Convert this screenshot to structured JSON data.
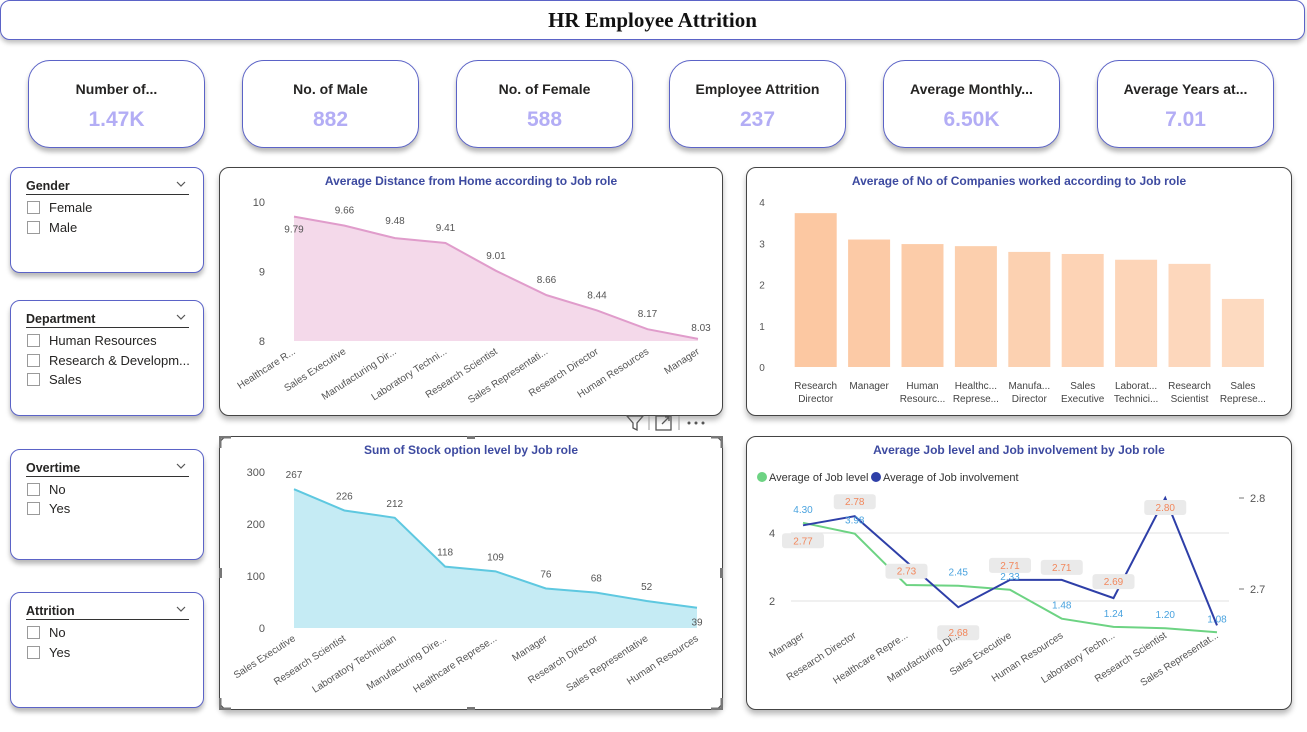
{
  "header": {
    "title": "HR Employee Attrition"
  },
  "kpis": [
    {
      "label": "Number of...",
      "value": "1.47K"
    },
    {
      "label": "No. of Male",
      "value": "882"
    },
    {
      "label": "No. of Female",
      "value": "588"
    },
    {
      "label": "Employee Attrition",
      "value": "237"
    },
    {
      "label": "Average Monthly...",
      "value": "6.50K"
    },
    {
      "label": "Average Years at...",
      "value": "7.01"
    }
  ],
  "slicers": [
    {
      "title": "Gender",
      "options": [
        "Female",
        "Male"
      ]
    },
    {
      "title": "Department",
      "options": [
        "Human Resources",
        "Research & Developm...",
        "Sales"
      ]
    },
    {
      "title": "Overtime",
      "options": [
        "No",
        "Yes"
      ]
    },
    {
      "title": "Attrition",
      "options": [
        "No",
        "Yes"
      ]
    }
  ],
  "colors": {
    "accent_border": "#5b63c7",
    "kpi_value": "#b3adf5",
    "chart_title": "#3d4aa0",
    "distance_line": "#e09ccb",
    "distance_fill": "#f4d9ea",
    "companies_bar": "#fcc8a2",
    "stock_line": "#5ec8e0",
    "stock_fill": "#c5ebf4",
    "job_level": "#6dd383",
    "job_involvement": "#2e3fa8",
    "label_orange": "#f2875c"
  },
  "icons": {
    "filter": "filter-icon",
    "focus": "focus-mode-icon",
    "more": "more-options-icon",
    "chevron": "chevron-down-icon"
  },
  "chart_data": [
    {
      "id": "distance",
      "type": "area",
      "title": "Average Distance from Home according to Job role",
      "categories": [
        "Healthcare R...",
        "Sales Executive",
        "Manufacturing Dir...",
        "Laboratory Techni...",
        "Research Scientist",
        "Sales Representati...",
        "Research Director",
        "Human Resources",
        "Manager"
      ],
      "values": [
        9.79,
        9.66,
        9.48,
        9.41,
        9.01,
        8.66,
        8.44,
        8.17,
        8.03
      ],
      "value_labels": [
        "9.79",
        "9.66",
        "9.48",
        "9.41",
        "9.01",
        "8.66",
        "8.44",
        "8.17",
        "8.03"
      ],
      "ylim": [
        8,
        10
      ],
      "yticks": [
        "8",
        "9",
        "10"
      ],
      "grid": false
    },
    {
      "id": "companies",
      "type": "bar",
      "title": "Average of No of Companies worked according to  Job role",
      "categories": [
        [
          "Research",
          "Director"
        ],
        [
          "Manager"
        ],
        [
          "Human",
          "Resourc..."
        ],
        [
          "Healthc...",
          "Represe..."
        ],
        [
          "Manufa...",
          "Director"
        ],
        [
          "Sales",
          "Executive"
        ],
        [
          "Laborat...",
          "Technici..."
        ],
        [
          "Research",
          "Scientist"
        ],
        [
          "Sales",
          "Represe..."
        ]
      ],
      "values": [
        3.73,
        3.09,
        2.98,
        2.93,
        2.79,
        2.74,
        2.6,
        2.5,
        1.65
      ],
      "ylim": [
        0,
        4
      ],
      "yticks": [
        "0",
        "1",
        "2",
        "3",
        "4"
      ],
      "grid": false
    },
    {
      "id": "stock",
      "type": "area",
      "title": "Sum of Stock option level by Job role",
      "categories": [
        "Sales Executive",
        "Research Scientist",
        "Laboratory Technician",
        "Manufacturing Dire...",
        "Healthcare Represe...",
        "Manager",
        "Research Director",
        "Sales Representative",
        "Human Resources"
      ],
      "values": [
        267,
        226,
        212,
        118,
        109,
        76,
        68,
        52,
        39
      ],
      "value_labels": [
        "267",
        "226",
        "212",
        "118",
        "109",
        "76",
        "68",
        "52",
        "39"
      ],
      "ylim": [
        0,
        300
      ],
      "yticks": [
        "0",
        "100",
        "200",
        "300"
      ],
      "grid": false
    },
    {
      "id": "joblevel",
      "type": "line",
      "title": "Average Job level and Job involvement by Job role",
      "categories": [
        "Manager",
        "Research Director",
        "Healthcare Repre...",
        "Manufacturing Di...",
        "Sales Executive",
        "Human Resources",
        "Laboratory Techn...",
        "Research Scientist",
        "Sales Representat..."
      ],
      "series": [
        {
          "name": "Average of Job level",
          "axis": "left",
          "values": [
            4.3,
            3.98,
            2.47,
            2.45,
            2.33,
            1.48,
            1.24,
            1.2,
            1.08
          ],
          "labels": [
            "4.30",
            "3.98",
            "2.47",
            "2.45",
            "2.33",
            "1.48",
            "1.24",
            "1.20",
            "1.08"
          ]
        },
        {
          "name": "Average of Job involvement",
          "axis": "right",
          "values": [
            2.77,
            2.78,
            2.73,
            2.68,
            2.71,
            2.71,
            2.69,
            2.8,
            2.66
          ],
          "labels": [
            "2.77",
            "2.78",
            "2.73",
            "2.68",
            "2.71",
            "2.71",
            "2.69",
            "2.80",
            ""
          ]
        }
      ],
      "yticks_left": [
        "2",
        "4"
      ],
      "yticks_right": [
        "2.7",
        "2.8"
      ],
      "legend": "top-left",
      "grid": true
    }
  ]
}
